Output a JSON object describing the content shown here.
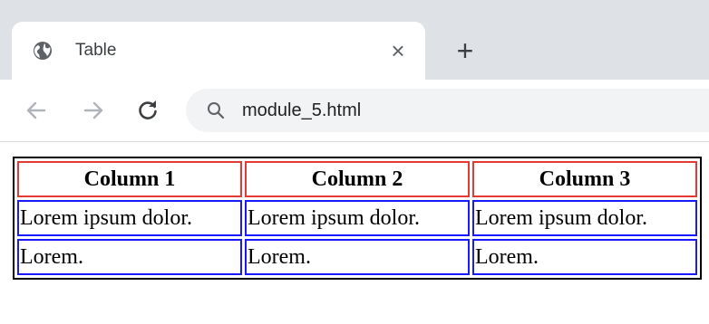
{
  "browser": {
    "tab": {
      "title": "Table",
      "icon": "globe-icon",
      "close_label": "×"
    },
    "new_tab_label": "+",
    "toolbar": {
      "back_icon": "back-arrow-icon",
      "forward_icon": "forward-arrow-icon",
      "reload_icon": "reload-icon",
      "address": "module_5.html",
      "search_icon": "search-icon"
    },
    "colors": {
      "tabstrip": "#dee1e6",
      "omnibox": "#f1f3f4"
    }
  },
  "table": {
    "headers": [
      "Column 1",
      "Column 2",
      "Column 3"
    ],
    "rows": [
      [
        "Lorem ipsum dolor.",
        "Lorem ipsum dolor.",
        "Lorem ipsum dolor."
      ],
      [
        "Lorem.",
        "Lorem.",
        "Lorem."
      ]
    ],
    "colors": {
      "table_border": "#000000",
      "header_border": "#e53935",
      "cell_border": "#1a1aff"
    }
  }
}
